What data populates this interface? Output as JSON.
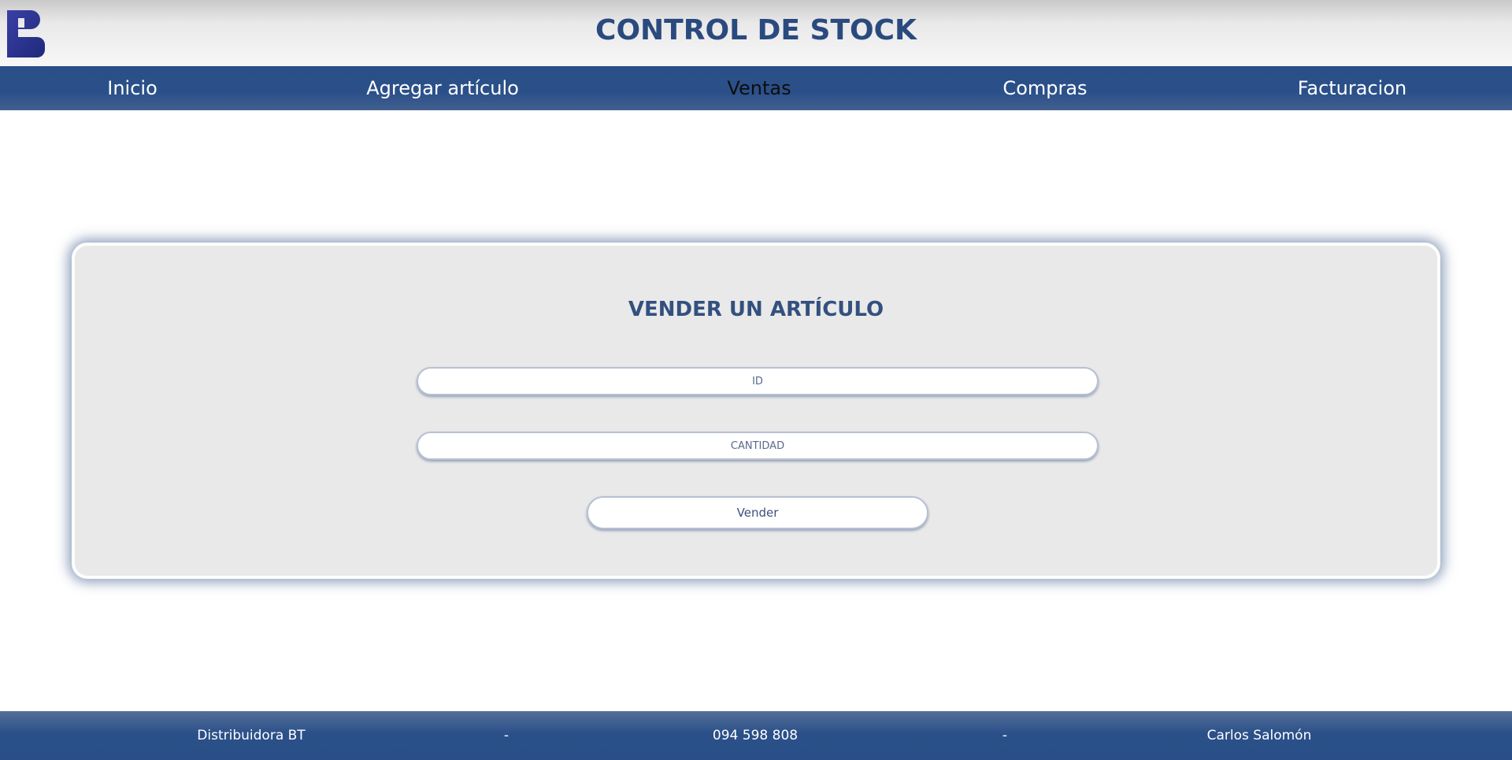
{
  "header": {
    "title": "CONTROL DE STOCK",
    "logo_icon": "brand-logo-icon",
    "colors": {
      "brand": "#2a4a7f",
      "logo_gradient": [
        "#3b3fa6",
        "#1e2a7a"
      ]
    }
  },
  "nav": {
    "items": [
      {
        "label": "Inicio",
        "active": false
      },
      {
        "label": "Agregar artículo",
        "active": false
      },
      {
        "label": "Ventas",
        "active": true
      },
      {
        "label": "Compras",
        "active": false
      },
      {
        "label": "Facturacion",
        "active": false
      }
    ],
    "colors": {
      "background": "#2b5089",
      "text": "#ffffff",
      "active_text": "#0d0d0d"
    }
  },
  "form": {
    "title": "VENDER UN ARTÍCULO",
    "id_field": {
      "placeholder": "ID",
      "value": ""
    },
    "quantity_field": {
      "placeholder": "CANTIDAD",
      "value": ""
    },
    "submit_label": "Vender",
    "colors": {
      "card_background": "#e9e9e9",
      "title": "#33507f"
    }
  },
  "footer": {
    "company": "Distribuidora BT",
    "separator_1": "-",
    "phone": "094 598 808",
    "separator_2": "-",
    "author": "Carlos Salomón",
    "colors": {
      "background": "#2b5089",
      "text": "#ffffff"
    }
  }
}
